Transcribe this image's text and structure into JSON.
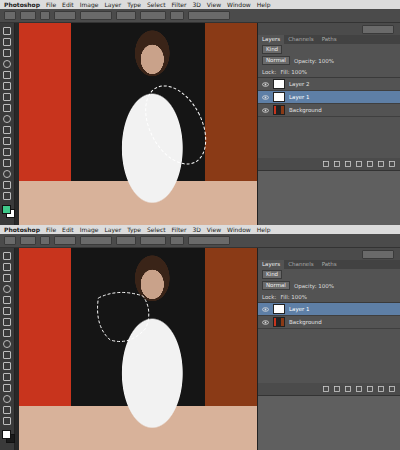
{
  "screens": [
    {
      "menus": [
        "Photoshop",
        "File",
        "Edit",
        "Image",
        "Layer",
        "Type",
        "Select",
        "Filter",
        "3D",
        "View",
        "Window",
        "Help"
      ],
      "panel_tabs": [
        {
          "label": "Layers",
          "selected": true
        },
        {
          "label": "Channels",
          "selected": false
        },
        {
          "label": "Paths",
          "selected": false
        }
      ],
      "filter": "Kind",
      "blend_mode": "Normal",
      "opacity": "Opacity: 100%",
      "lock": "Lock:",
      "fill": "Fill: 100%",
      "layers": [
        {
          "name": "Layer 2",
          "selected": false,
          "visible": true,
          "kind": "blank"
        },
        {
          "name": "Layer 1",
          "selected": true,
          "visible": true,
          "kind": "blank"
        },
        {
          "name": "Background",
          "selected": false,
          "visible": true,
          "kind": "photo"
        }
      ],
      "selection": {
        "kind": "ellipse"
      },
      "swatches": {
        "foreground": "#3fc98a",
        "background": "#ffffff"
      }
    },
    {
      "menus": [
        "Photoshop",
        "File",
        "Edit",
        "Image",
        "Layer",
        "Type",
        "Select",
        "Filter",
        "3D",
        "View",
        "Window",
        "Help"
      ],
      "panel_tabs": [
        {
          "label": "Layers",
          "selected": true
        },
        {
          "label": "Channels",
          "selected": false
        },
        {
          "label": "Paths",
          "selected": false
        }
      ],
      "filter": "Kind",
      "blend_mode": "Normal",
      "opacity": "Opacity: 100%",
      "lock": "Lock:",
      "fill": "Fill: 100%",
      "layers": [
        {
          "name": "Layer 1",
          "selected": true,
          "visible": true,
          "kind": "blank"
        },
        {
          "name": "Background",
          "selected": false,
          "visible": true,
          "kind": "photo"
        }
      ],
      "selection": {
        "kind": "lasso"
      },
      "swatches": {
        "foreground": "#ffffff",
        "background": "#1a1a1a"
      }
    }
  ]
}
